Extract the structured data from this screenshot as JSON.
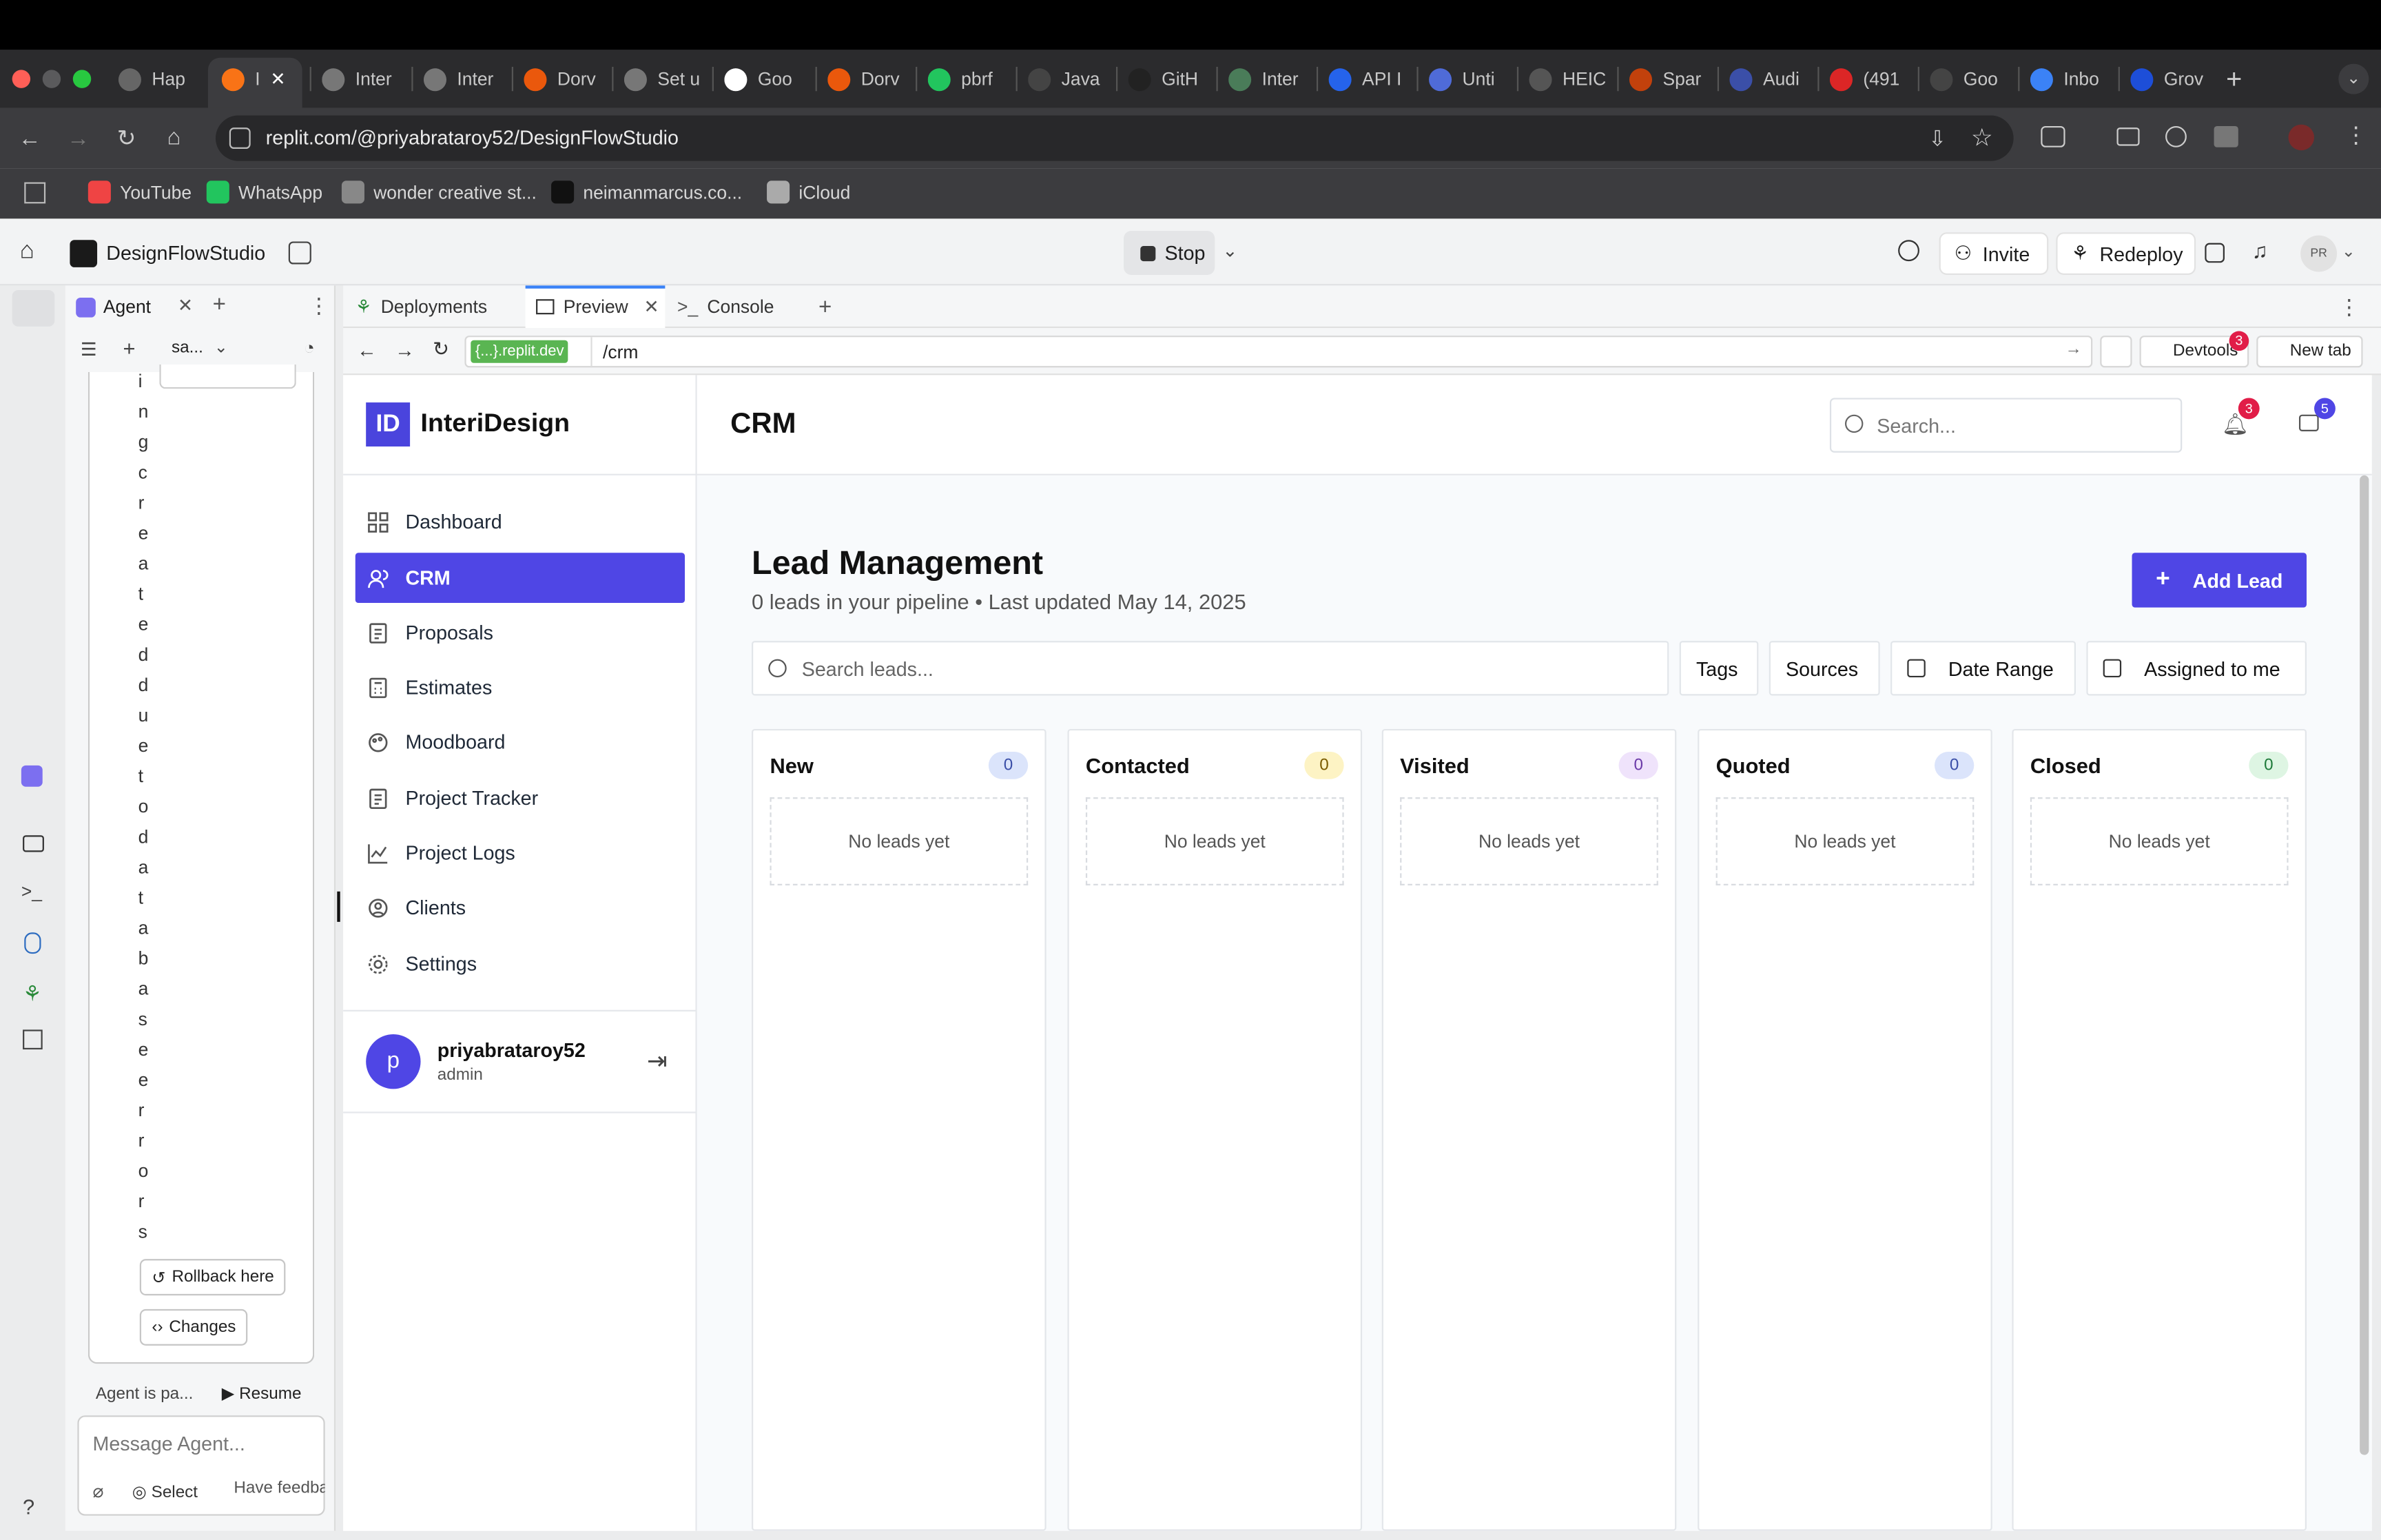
{
  "browser": {
    "tabs": [
      "Hap",
      "I",
      "Inter",
      "Inter",
      "Dorv",
      "Set u",
      "Goo",
      "Dorv",
      "pbrf",
      "Java",
      "GitH",
      "Inter",
      "API I",
      "Unti",
      "HEIC",
      "Spar",
      "Audi",
      "(491",
      "Goo",
      "Inbo",
      "Grov"
    ],
    "url": "replit.com/@priyabrataroy52/DesignFlowStudio",
    "bookmarks": [
      "YouTube",
      "WhatsApp",
      "wonder creative st...",
      "neimanmarcus.co...",
      "iCloud"
    ]
  },
  "replit": {
    "project_name": "DesignFlowStudio",
    "stop_label": "Stop",
    "invite_label": "Invite",
    "redeploy_label": "Redeploy",
    "avatar_initials": "PR",
    "agent_tab": "Agent",
    "agent_sub": "sa...",
    "agent_vertical_text": "ingcreateddue to databaseerrors",
    "rollback_label": "Rollback here",
    "changes_label": "Changes",
    "agent_status": "Agent is pa...",
    "resume_label": "Resume",
    "message_placeholder": "Message Agent...",
    "select_label": "Select",
    "feedback_label": "Have feedback",
    "panel_tabs": [
      "Deployments",
      "Preview",
      "Console"
    ],
    "preview_domain": "{...}.replit.dev",
    "preview_path": "/crm",
    "devtools_label": "Devtools",
    "devtools_badge": "3",
    "newtab_label": "New tab"
  },
  "app": {
    "logo_mark": "ID",
    "logo_name": "InteriDesign",
    "page_title": "CRM",
    "search_placeholder": "Search...",
    "notif_count": "3",
    "msg_count": "5",
    "nav": [
      "Dashboard",
      "CRM",
      "Proposals",
      "Estimates",
      "Moodboard",
      "Project Tracker",
      "Project Logs",
      "Clients",
      "Settings"
    ],
    "user": {
      "initial": "p",
      "name": "priyabrataroy52",
      "role": "admin"
    },
    "heading": "Lead Management",
    "subheading": "0 leads in your pipeline • Last updated May 14, 2025",
    "add_lead_label": "Add Lead",
    "search_leads_placeholder": "Search leads...",
    "filters": [
      "Tags",
      "Sources",
      "Date Range",
      "Assigned to me"
    ],
    "columns": [
      {
        "name": "New",
        "count": "0",
        "badge_bg": "#dbe4fb",
        "badge_fg": "#3b4fa8"
      },
      {
        "name": "Contacted",
        "count": "0",
        "badge_bg": "#fdf3c4",
        "badge_fg": "#7a5b00"
      },
      {
        "name": "Visited",
        "count": "0",
        "badge_bg": "#efe3fb",
        "badge_fg": "#6b3aa8"
      },
      {
        "name": "Quoted",
        "count": "0",
        "badge_bg": "#dbe4fb",
        "badge_fg": "#3b4fa8"
      },
      {
        "name": "Closed",
        "count": "0",
        "badge_bg": "#def5e3",
        "badge_fg": "#1e7a3a"
      }
    ],
    "empty_label": "No leads yet"
  },
  "colors": {
    "accent": "#4f46e5",
    "badge_red": "#e11d48"
  }
}
